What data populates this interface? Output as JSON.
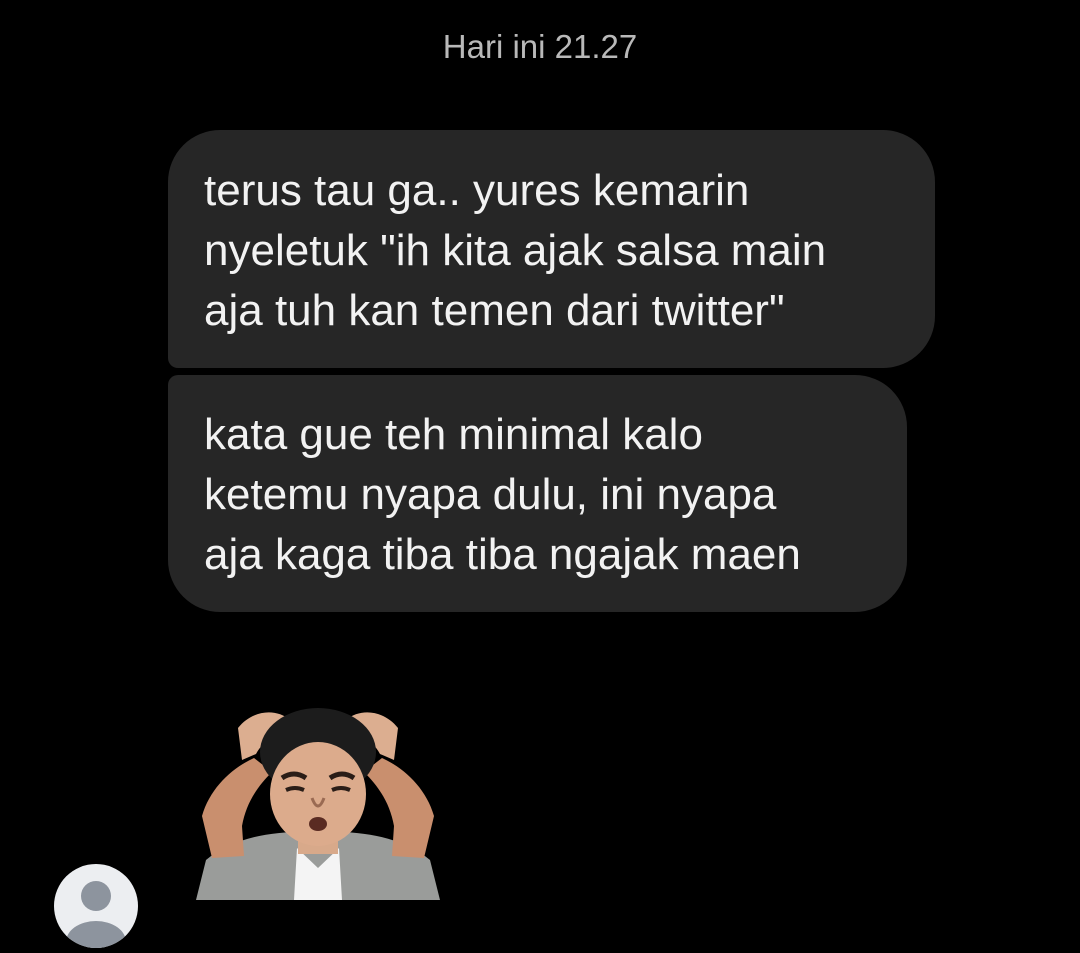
{
  "chat": {
    "timestamp": "Hari ini 21.27",
    "messages": [
      {
        "text": "terus tau ga.. yures kemarin\nnyeletuk \"ih kita ajak salsa main\naja tuh kan temen dari twitter\""
      },
      {
        "text": "kata gue teh minimal kalo\nketemu nyapa dulu, ini nyapa\naja kaga tiba tiba ngajak maen"
      }
    ],
    "sticker": {
      "icon": "man-holding-head-sticker"
    },
    "sender": {
      "avatar_icon": "person-icon"
    }
  },
  "colors": {
    "background": "#000000",
    "bubble": "#262626",
    "bubble_text": "#f2f2f2",
    "timestamp_text": "#b9b9b9",
    "avatar_bg": "#eceef1",
    "avatar_figure": "#8d949e"
  }
}
